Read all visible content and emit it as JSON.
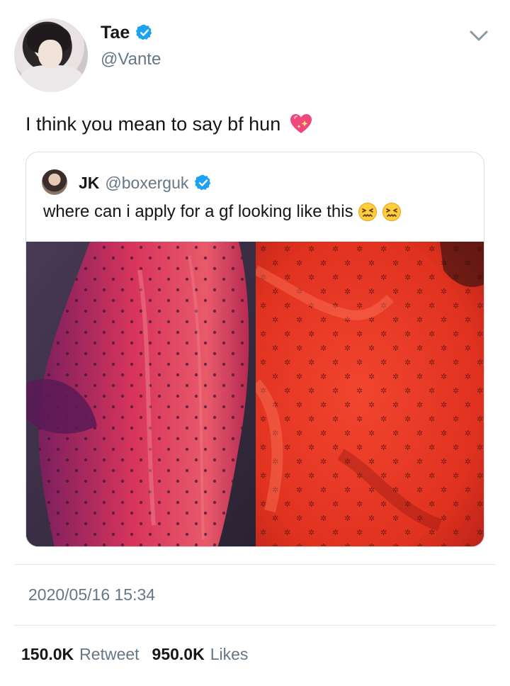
{
  "tweet": {
    "author_name": "Tae",
    "author_handle": "@Vante",
    "text": "I think you mean to say bf hun",
    "text_emoji": "sparkling-heart",
    "verified_color": "#1da1f2"
  },
  "quote": {
    "author_name": "JK",
    "author_handle": "@boxerguk",
    "text": "where can i apply for a gf looking like this",
    "text_emojis": [
      "confounded-face",
      "confounded-face"
    ]
  },
  "footer": {
    "timestamp": "2020/05/16 15:34",
    "retweet_count": "150.0K",
    "retweet_label": "Retweet",
    "likes_count": "950.0K",
    "likes_label": "Likes"
  },
  "colors": {
    "text_primary": "#14171a",
    "text_secondary": "#657786",
    "border": "#e1e8ed",
    "accent": "#1da1f2"
  }
}
